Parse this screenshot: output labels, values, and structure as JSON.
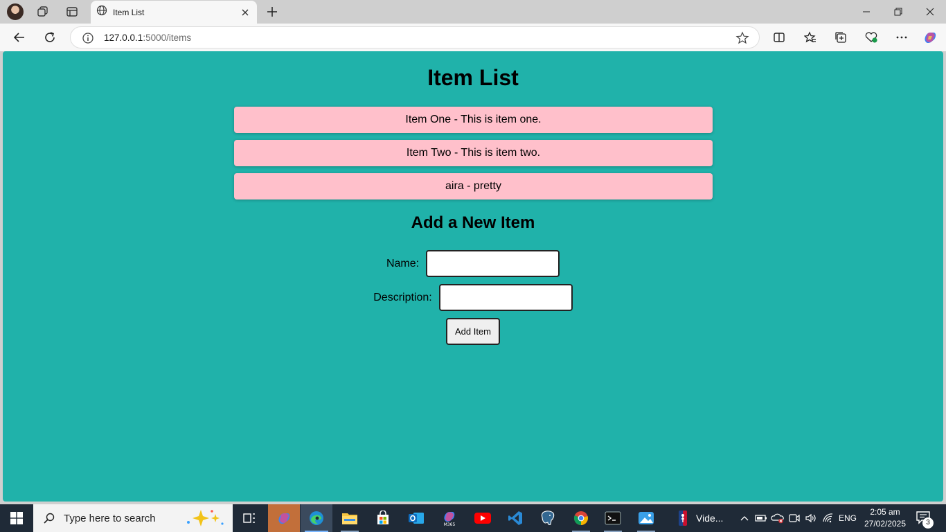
{
  "browser": {
    "tab": {
      "title": "Item List"
    },
    "address": {
      "host": "127.0.0.1",
      "path": ":5000/items"
    }
  },
  "page": {
    "title": "Item List",
    "items": [
      {
        "text": "Item One - This is item one."
      },
      {
        "text": "Item Two - This is item two."
      },
      {
        "text": "aira - pretty"
      }
    ],
    "form": {
      "title": "Add a New Item",
      "name_label": "Name:",
      "name_value": "",
      "description_label": "Description:",
      "description_value": "",
      "submit_label": "Add Item"
    }
  },
  "taskbar": {
    "search_placeholder": "Type here to search",
    "running_label": "Vide...",
    "language": "ENG",
    "time": "2:05 am",
    "date": "27/02/2025",
    "notification_count": "3"
  },
  "colors": {
    "page_background": "#20b2aa",
    "item_background": "#ffc0cb"
  }
}
